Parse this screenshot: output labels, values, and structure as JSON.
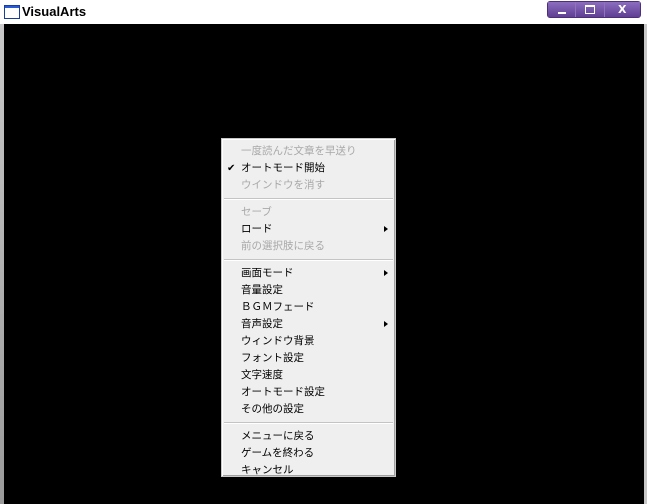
{
  "window": {
    "title": "VisualArts",
    "minimize_symbol": "",
    "maximize_symbol": "",
    "close_symbol": "X"
  },
  "menu": {
    "groups": [
      {
        "items": [
          {
            "label": "一度読んだ文章を早送り",
            "enabled": false
          },
          {
            "label": "オートモード開始",
            "enabled": true,
            "checked": true,
            "check_glyph": "✔"
          },
          {
            "label": "ウインドウを消す",
            "enabled": false
          }
        ]
      },
      {
        "items": [
          {
            "label": "セーブ",
            "enabled": false
          },
          {
            "label": "ロード",
            "enabled": true,
            "submenu": true
          },
          {
            "label": "前の選択肢に戻る",
            "enabled": false
          }
        ]
      },
      {
        "items": [
          {
            "label": "画面モード",
            "enabled": true,
            "submenu": true
          },
          {
            "label": "音量設定",
            "enabled": true
          },
          {
            "label": "ＢＧＭフェード",
            "enabled": true
          },
          {
            "label": "音声設定",
            "enabled": true,
            "submenu": true
          },
          {
            "label": "ウィンドウ背景",
            "enabled": true
          },
          {
            "label": "フォント設定",
            "enabled": true
          },
          {
            "label": "文字速度",
            "enabled": true
          },
          {
            "label": "オートモード設定",
            "enabled": true
          },
          {
            "label": "その他の設定",
            "enabled": true
          }
        ]
      },
      {
        "items": [
          {
            "label": "メニューに戻る",
            "enabled": true
          },
          {
            "label": "ゲームを終わる",
            "enabled": true
          },
          {
            "label": "キャンセル",
            "enabled": true
          }
        ]
      }
    ]
  },
  "colors": {
    "menu_background": "#efefef",
    "disabled_text": "#a8a8a8",
    "client_background": "#000000",
    "caption_buttons": "#6f4fa0"
  }
}
